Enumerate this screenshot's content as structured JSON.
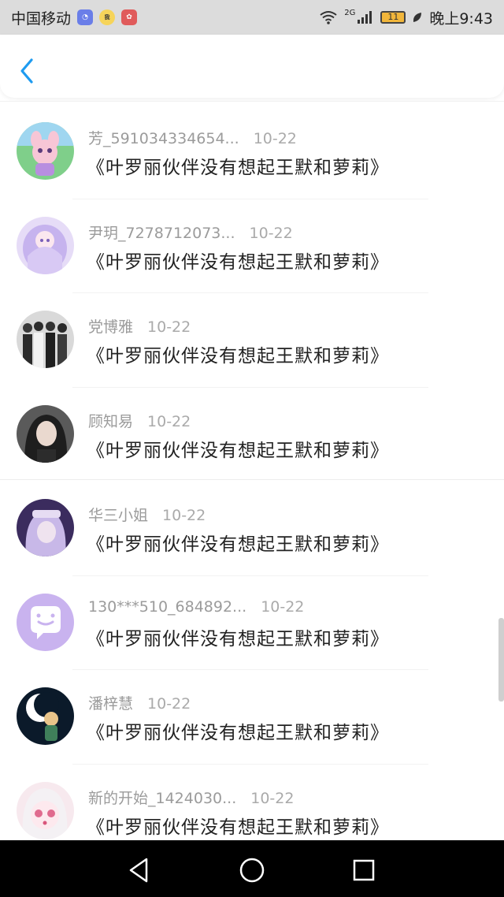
{
  "status_bar": {
    "carrier": "中国移动",
    "mini_icons": [
      "chat-bubble-app-icon",
      "wallet-app-icon",
      "huawei-store-icon"
    ],
    "network": "2G",
    "battery": "11",
    "time": "晚上9:43"
  },
  "header": {
    "title": ""
  },
  "items": [
    {
      "user": "芳_591034334654...",
      "date": "10-22",
      "message": "《叶罗丽伙伴没有想起王默和萝莉》",
      "avatar": "cartoon-character-avatar"
    },
    {
      "user": "尹玥_7278712073...",
      "date": "10-22",
      "message": "《叶罗丽伙伴没有想起王默和萝莉》",
      "avatar": "anime-girl-avatar"
    },
    {
      "user": "党博雅",
      "date": "10-22",
      "message": "《叶罗丽伙伴没有想起王默和萝莉》",
      "avatar": "group-photo-avatar"
    },
    {
      "user": "顾知易",
      "date": "10-22",
      "message": "《叶罗丽伙伴没有想起王默和萝莉》",
      "avatar": "portrait-avatar"
    },
    {
      "user": "华三小姐",
      "date": "10-22",
      "message": "《叶罗丽伙伴没有想起王默和萝莉》",
      "avatar": "purple-hood-avatar"
    },
    {
      "user": "130***510_684892...",
      "date": "10-22",
      "message": "《叶罗丽伙伴没有想起王默和萝莉》",
      "avatar": "default-chat-avatar"
    },
    {
      "user": "潘梓慧",
      "date": "10-22",
      "message": "《叶罗丽伙伴没有想起王默和萝莉》",
      "avatar": "night-moon-avatar"
    },
    {
      "user": "新的开始_1424030...",
      "date": "10-22",
      "message": "《叶罗丽伙伴没有想起王默和萝莉》",
      "avatar": "pink-anime-avatar"
    }
  ],
  "colors": {
    "status_bg": "#dcdcdc",
    "accent_back": "#1e9bf0",
    "name_text": "#9b9b9b",
    "message_text": "#222222",
    "nav_bg": "#000000"
  }
}
